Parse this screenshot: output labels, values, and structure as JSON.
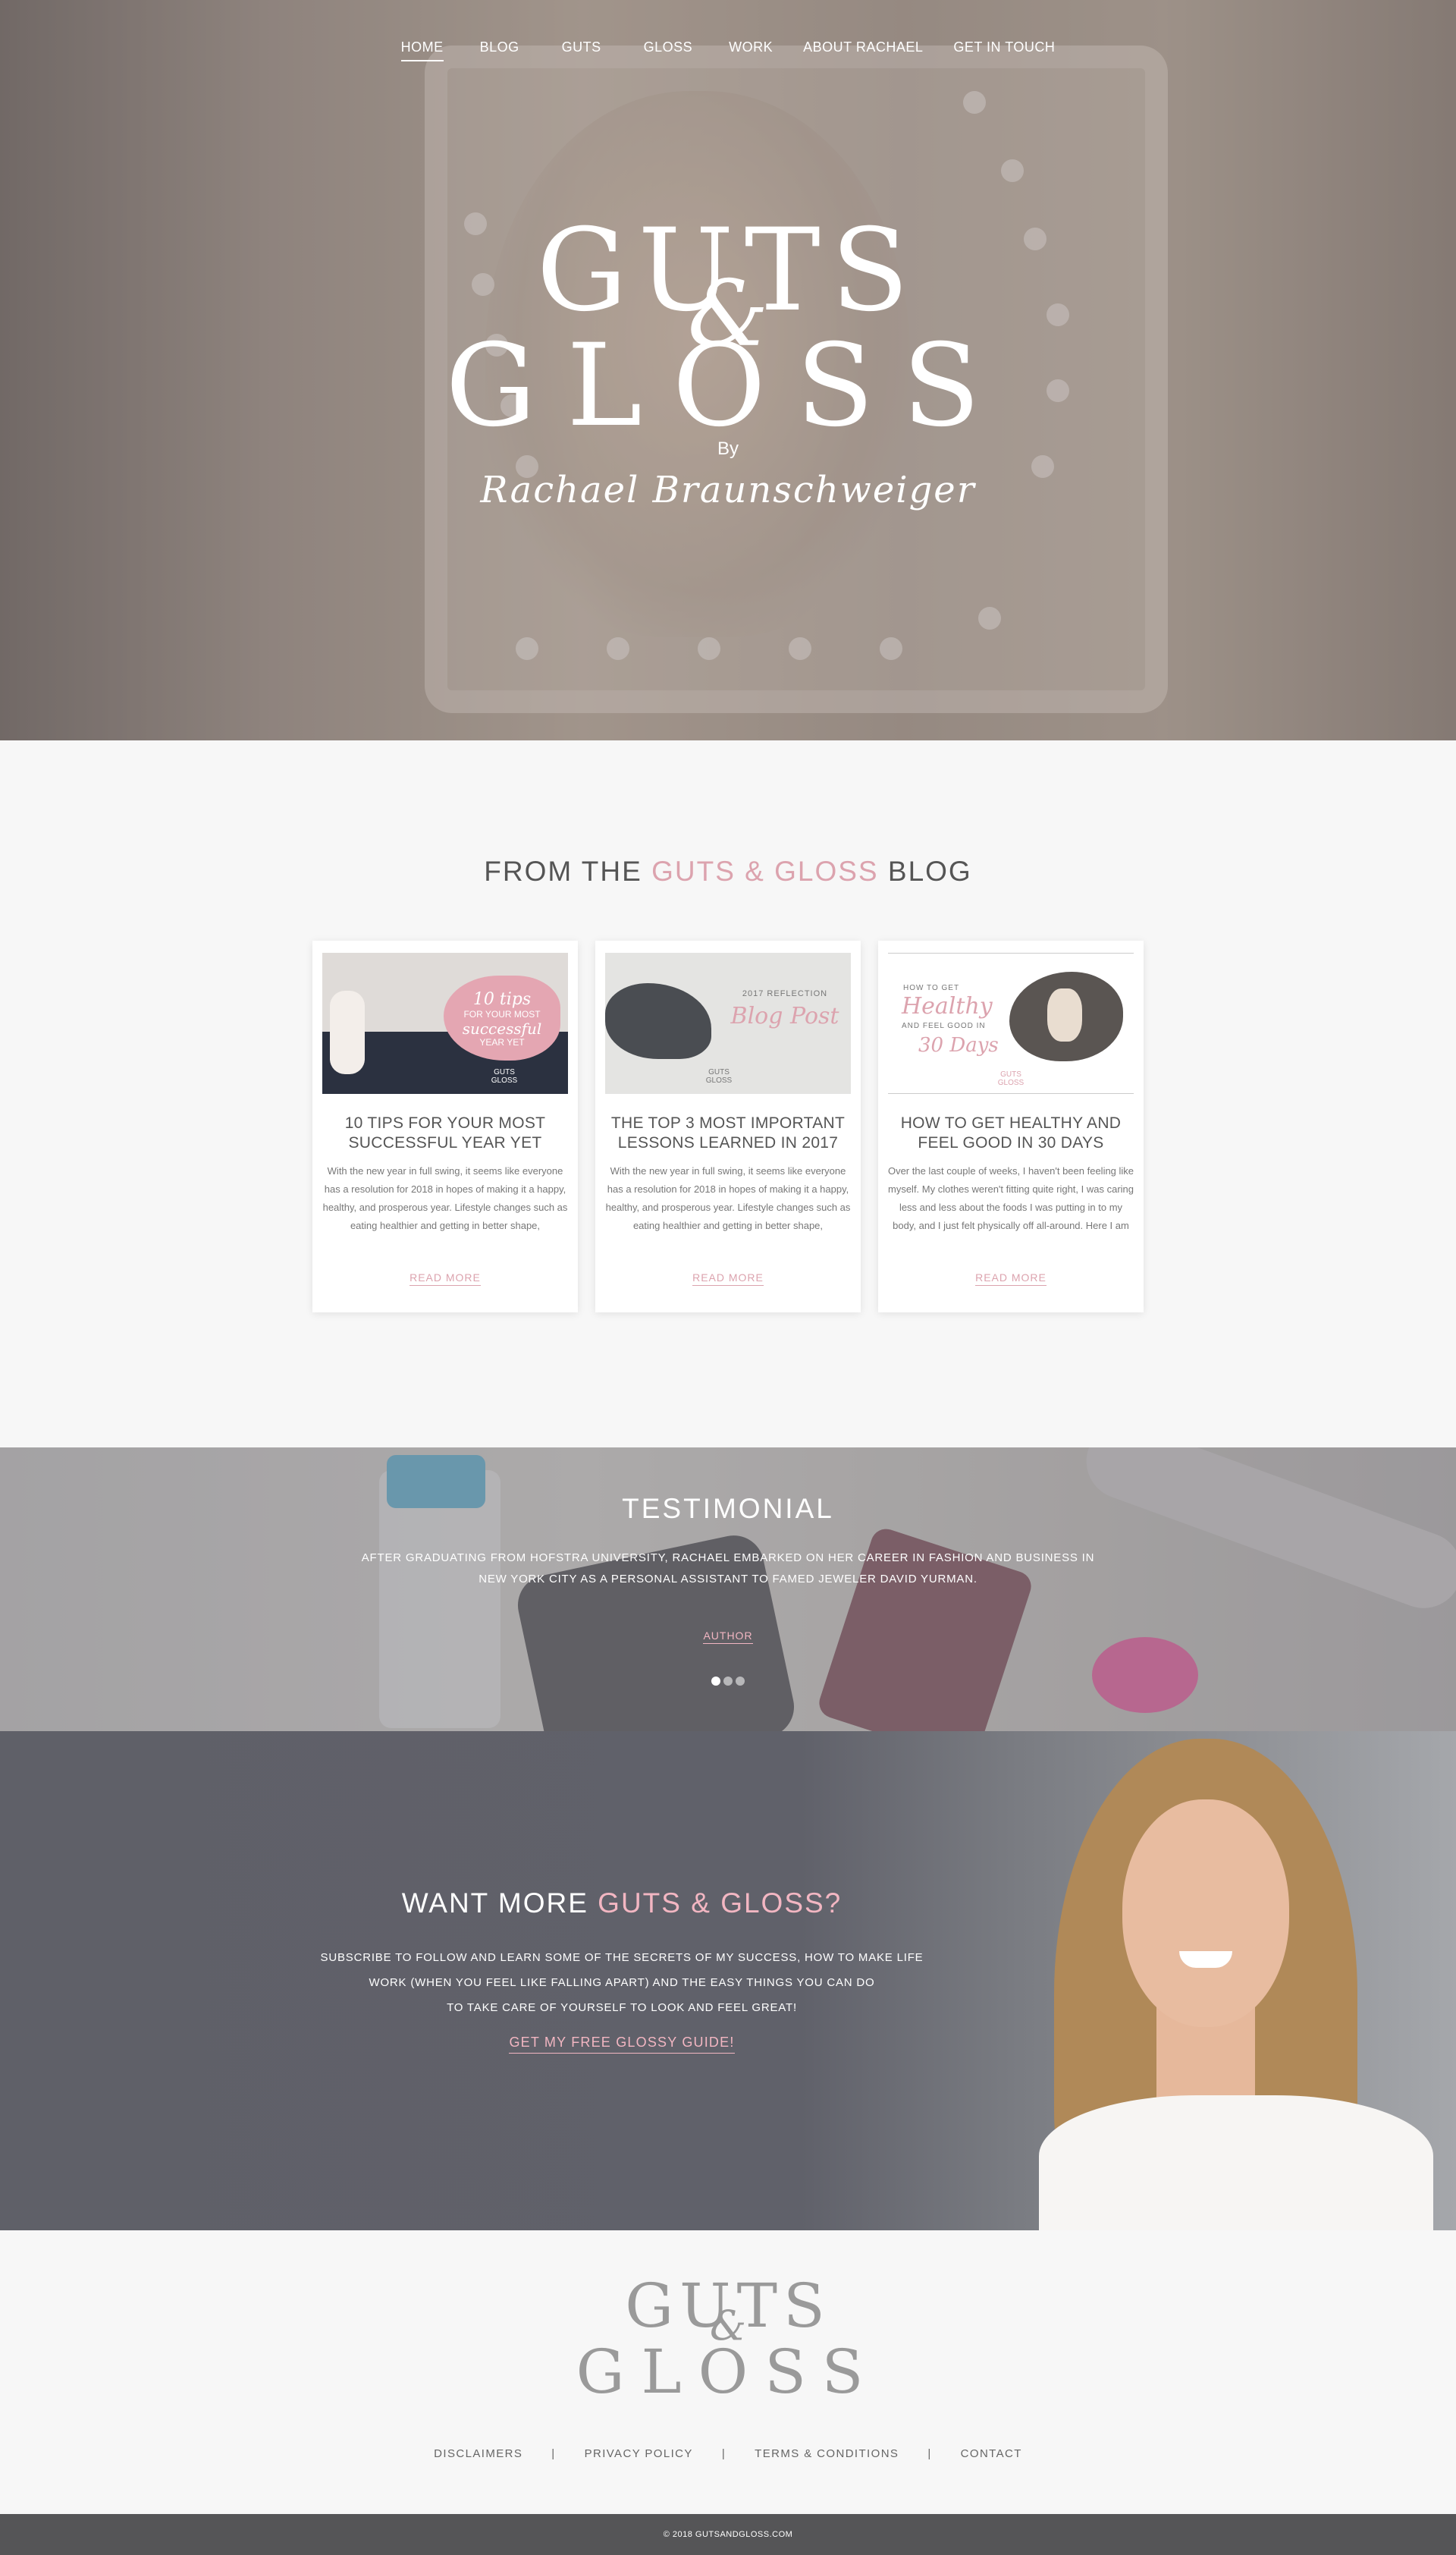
{
  "nav": {
    "items": [
      {
        "label": "HOME",
        "active": true
      },
      {
        "label": "BLOG"
      },
      {
        "label": "GUTS"
      },
      {
        "label": "GLOSS"
      },
      {
        "label": "WORK"
      },
      {
        "label": "ABOUT RACHAEL"
      },
      {
        "label": "GET IN TOUCH"
      }
    ]
  },
  "hero": {
    "logo_line1": "GUTS",
    "logo_amp": "&",
    "logo_line2": "GLOSS",
    "by": "By",
    "signature": "Rachael Braunschweiger"
  },
  "blog": {
    "title_prefix": "FROM THE ",
    "title_highlight": "GUTS & GLOSS",
    "title_suffix": " BLOG",
    "posts": [
      {
        "title": "10 TIPS FOR YOUR MOST SUCCESSFUL YEAR YET",
        "excerpt": "With the new year in full swing, it seems like everyone has a resolution for 2018 in hopes of making it a happy, healthy, and prosperous year. Lifestyle changes such as eating healthier and getting in better shape,",
        "read_more": "READ MORE",
        "thumb": {
          "script": "10 tips",
          "line1": "FOR YOUR MOST",
          "script2": "successful",
          "line2": "YEAR YET",
          "tag1": "GUTS",
          "tag2": "GLOSS"
        }
      },
      {
        "title": "THE TOP 3 MOST IMPORTANT LESSONS LEARNED IN 2017",
        "excerpt": "With the new year in full swing, it seems like everyone has a resolution for 2018 in hopes of making it a happy, healthy, and prosperous year. Lifestyle changes such as eating healthier and getting in better shape,",
        "read_more": "READ MORE",
        "thumb": {
          "caption": "2017 REFLECTION",
          "script": "Blog Post",
          "tag1": "GUTS",
          "tag2": "GLOSS"
        }
      },
      {
        "title": "HOW TO GET HEALTHY AND FEEL GOOD IN 30 DAYS",
        "excerpt": "Over the last couple of weeks, I haven't been feeling like myself. My clothes weren't fitting quite right, I was caring less and less about the foods I was putting in to my body, and I just felt physically off all-around. Here I am",
        "read_more": "READ MORE",
        "thumb": {
          "line1": "HOW TO GET",
          "script": "Healthy",
          "line2": "AND FEEL GOOD IN",
          "script2": "30 Days",
          "tag1": "GUTS",
          "tag2": "GLOSS"
        }
      }
    ]
  },
  "testimonial": {
    "title": "TESTIMONIAL",
    "quote": "AFTER GRADUATING FROM HOFSTRA UNIVERSITY, RACHAEL EMBARKED ON HER CAREER IN FASHION AND BUSINESS IN NEW YORK CITY AS A PERSONAL ASSISTANT TO FAMED JEWELER DAVID YURMAN.",
    "author": "AUTHOR",
    "dots": 3,
    "active_dot": 1
  },
  "subscribe": {
    "title_prefix": "WANT MORE ",
    "title_highlight": "GUTS & GLOSS?",
    "line1": "SUBSCRIBE TO FOLLOW AND LEARN SOME OF THE SECRETS OF MY SUCCESS, HOW TO MAKE LIFE",
    "line2": "WORK (WHEN YOU FEEL LIKE FALLING APART) AND THE EASY THINGS YOU CAN DO",
    "line3": "TO TAKE CARE OF YOURSELF TO LOOK AND FEEL GREAT!",
    "cta": "GET MY FREE GLOSSY GUIDE!"
  },
  "footer": {
    "logo_line1": "GUTS",
    "logo_amp": "&",
    "logo_line2": "GLOSS",
    "links": [
      "DISCLAIMERS",
      "PRIVACY POLICY",
      "TERMS & CONDITIONS",
      "CONTACT"
    ],
    "separator": "|",
    "copyright": "© 2018 GUTSANDGLOSS.COM"
  },
  "colors": {
    "accent_pink": "#dca3ae",
    "text_gray": "#555555",
    "footer_bar": "#555557"
  }
}
